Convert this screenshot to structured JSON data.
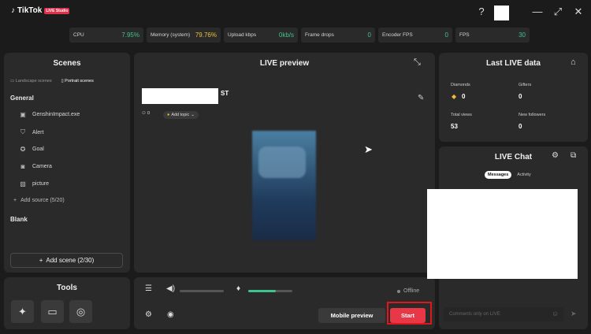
{
  "app": {
    "logo_text": "TikTok",
    "logo_badge": "LIVE Studio"
  },
  "window_controls": {
    "help": "?",
    "minimize": "—",
    "maximize": "⤢",
    "close": "✕"
  },
  "stats": [
    {
      "label": "CPU",
      "value": "7.95%",
      "status": "ok"
    },
    {
      "label": "Memory (system)",
      "value": "79.76%",
      "status": "warn"
    },
    {
      "label": "Upload kbps",
      "value": "0kb/s",
      "status": "ok"
    },
    {
      "label": "Frame drops",
      "value": "0",
      "status": "ok"
    },
    {
      "label": "Encoder FPS",
      "value": "0",
      "status": "ok"
    },
    {
      "label": "FPS",
      "value": "30",
      "status": "ok"
    }
  ],
  "scenes": {
    "title": "Scenes",
    "tabs": {
      "landscape": "Landscape scenes",
      "portrait": "Portrait scenes"
    },
    "general_label": "General",
    "sources": [
      {
        "label": "GenshinImpact.exe",
        "icon": "window-icon"
      },
      {
        "label": "Alert",
        "icon": "trophy-icon"
      },
      {
        "label": "Goal",
        "icon": "medal-icon"
      },
      {
        "label": "Camera",
        "icon": "camera-icon"
      },
      {
        "label": "picture",
        "icon": "image-icon"
      }
    ],
    "add_source": "Add source (5/20)",
    "blank_label": "Blank",
    "add_scene": "Add scene (2/30)"
  },
  "tools": {
    "title": "Tools"
  },
  "preview": {
    "title": "LIVE preview",
    "name_suffix": "ST",
    "viewer_count": "0",
    "add_topic": "Add topic"
  },
  "controls": {
    "audio_level": 0.0,
    "mic_level": 0.62,
    "status": "Offline",
    "mobile_preview": "Mobile preview",
    "start": "Start"
  },
  "last_live": {
    "title": "Last LIVE data",
    "diamonds_label": "Diamonds",
    "diamonds_value": "0",
    "gifters_label": "Gifters",
    "gifters_value": "0",
    "total_views_label": "Total views",
    "total_views_value": "53",
    "new_followers_label": "New followers",
    "new_followers_value": "0"
  },
  "chat": {
    "title": "LIVE Chat",
    "tabs": [
      "Messages",
      "Activity"
    ],
    "input_placeholder": "Comments only on LIVE"
  },
  "colors": {
    "accent": "#e83747",
    "ok": "#3fc38e",
    "warn": "#e9c23a"
  }
}
